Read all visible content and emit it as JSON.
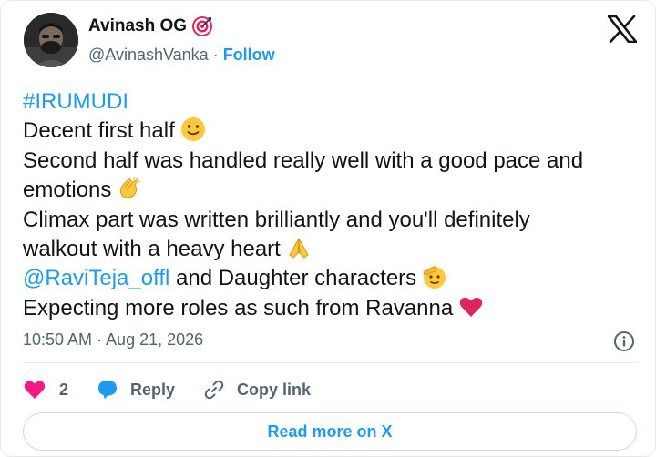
{
  "author": {
    "name": "Avinash OG",
    "handle": "@AvinashVanka",
    "separator": "·",
    "follow_label": "Follow"
  },
  "tweet": {
    "hashtag": "#IRUMUDI",
    "line1": "Decent first half",
    "line2": "Second half was handled really well with a good pace and",
    "line3": "emotions",
    "line4": "Climax part was written brilliantly and you'll definitely",
    "line5": "walkout with a heavy heart",
    "mention": "@RaviTeja_offl",
    "line6_rest": " and Daughter characters",
    "line7": "Expecting more roles as such from Ravanna"
  },
  "meta": {
    "timestamp": "10:50 AM · Aug 21, 2026"
  },
  "actions": {
    "like_count": "2",
    "reply_label": "Reply",
    "copy_label": "Copy link"
  },
  "read_more_label": "Read more on X",
  "colors": {
    "accent": "#1d9bf0",
    "text": "#0f1419",
    "muted": "#536471",
    "like": "#f91880",
    "badge": "#e0245e"
  },
  "icons": [
    "avatar",
    "target-badge-icon",
    "x-logo-icon",
    "slight-smile-emoji-icon",
    "clapping-hands-emoji-icon",
    "folded-hands-emoji-icon",
    "saluting-face-emoji-icon",
    "red-heart-emoji-icon",
    "info-icon",
    "heart-icon",
    "reply-bubble-icon",
    "link-icon"
  ]
}
